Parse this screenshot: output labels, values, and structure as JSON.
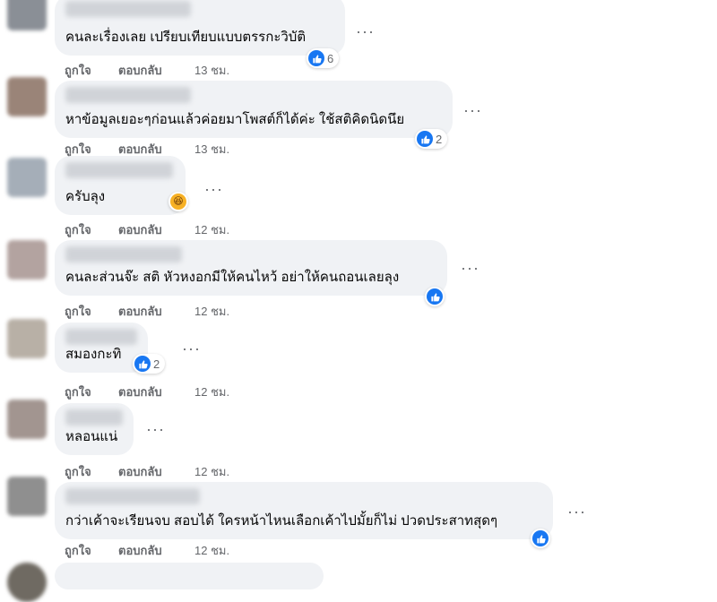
{
  "actions": {
    "like": "ถูกใจ",
    "reply": "ตอบกลับ"
  },
  "more_label": "···",
  "colors": {
    "like_blue": "#1877f2",
    "bubble_bg": "#f0f2f5",
    "meta_gray": "#65676b"
  },
  "comments": [
    {
      "text": "คนละเรื่องเลย เปรียบเทียบแบบตรรกะวิบัติ",
      "reaction": "like",
      "reaction_count": "6",
      "time": "13 ชม."
    },
    {
      "text": "หาข้อมูลเยอะๆก่อนแล้วค่อยมาโพสต์ก็ได้ค่ะ ใช้สติคิดนิดนึย",
      "reaction": "like",
      "reaction_count": "2",
      "time": "13 ชม."
    },
    {
      "text": "ครับลุง",
      "reaction": "haha",
      "reaction_count": "",
      "time": "12 ชม."
    },
    {
      "text": "คนละส่วนจ๊ะ สติ หัวหงอกมีให้คนไหว้ อย่าให้คนถอนเลยลุง",
      "reaction": "like",
      "reaction_count": "",
      "time": "12 ชม."
    },
    {
      "text": "สมองกะทิ",
      "reaction": "like",
      "reaction_count": "2",
      "time": "12 ชม."
    },
    {
      "text": "หลอนแน่",
      "reaction": "",
      "reaction_count": "",
      "time": "12 ชม."
    },
    {
      "text": "กว่าเค้าจะเรียนจบ สอบได้ ใครหน้าไหนเลือกเค้าไปมั้ยก็ไม่ ปวดประสาทสุดๆ",
      "reaction": "like",
      "reaction_count": "",
      "time": "12 ชม."
    }
  ]
}
